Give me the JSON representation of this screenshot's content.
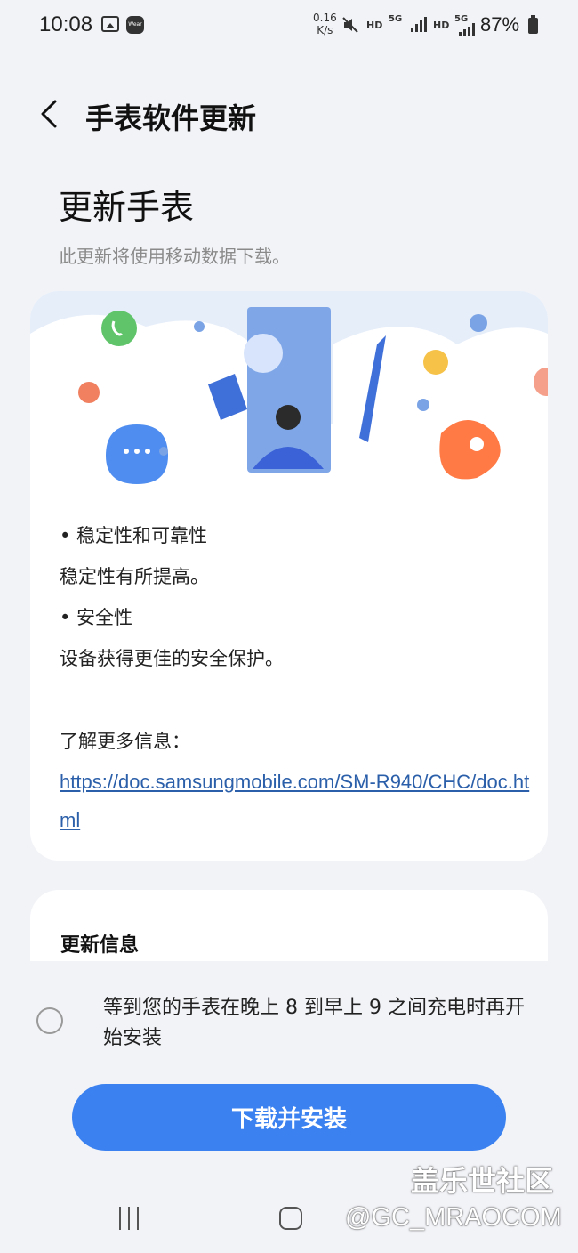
{
  "status_bar": {
    "time": "10:08",
    "net_speed_value": "0.16",
    "net_speed_unit": "K/s",
    "hd1": "HD",
    "network1": "5G",
    "hd2": "HD",
    "network2": "5G",
    "battery": "87%",
    "icons": [
      "gallery-icon",
      "wear-icon",
      "mute-icon",
      "signal-icon",
      "battery-icon"
    ]
  },
  "header": {
    "title": "手表软件更新"
  },
  "hero": {
    "title": "更新手表",
    "subtitle": "此更新将使用移动数据下载。"
  },
  "release_notes": {
    "items": [
      "• 稳定性和可靠性",
      "稳定性有所提高。",
      "• 安全性",
      "设备获得更佳的安全保护。"
    ],
    "learn_more_label": "了解更多信息：",
    "link": "https://doc.samsungmobile.com/SM-R940/CHC/doc.html"
  },
  "update_info": {
    "title": "更新信息"
  },
  "schedule_option": {
    "label": "等到您的手表在晚上 8 到早上 9 之间充电时再开始安装",
    "selected": false
  },
  "install_button_label": "下载并安装",
  "watermark": {
    "name": "盖乐世社区",
    "handle": "@GC_MRAOCOM"
  },
  "colors": {
    "accent": "#3b82f0",
    "link": "#2b5fa9",
    "background": "#f2f3f7"
  }
}
